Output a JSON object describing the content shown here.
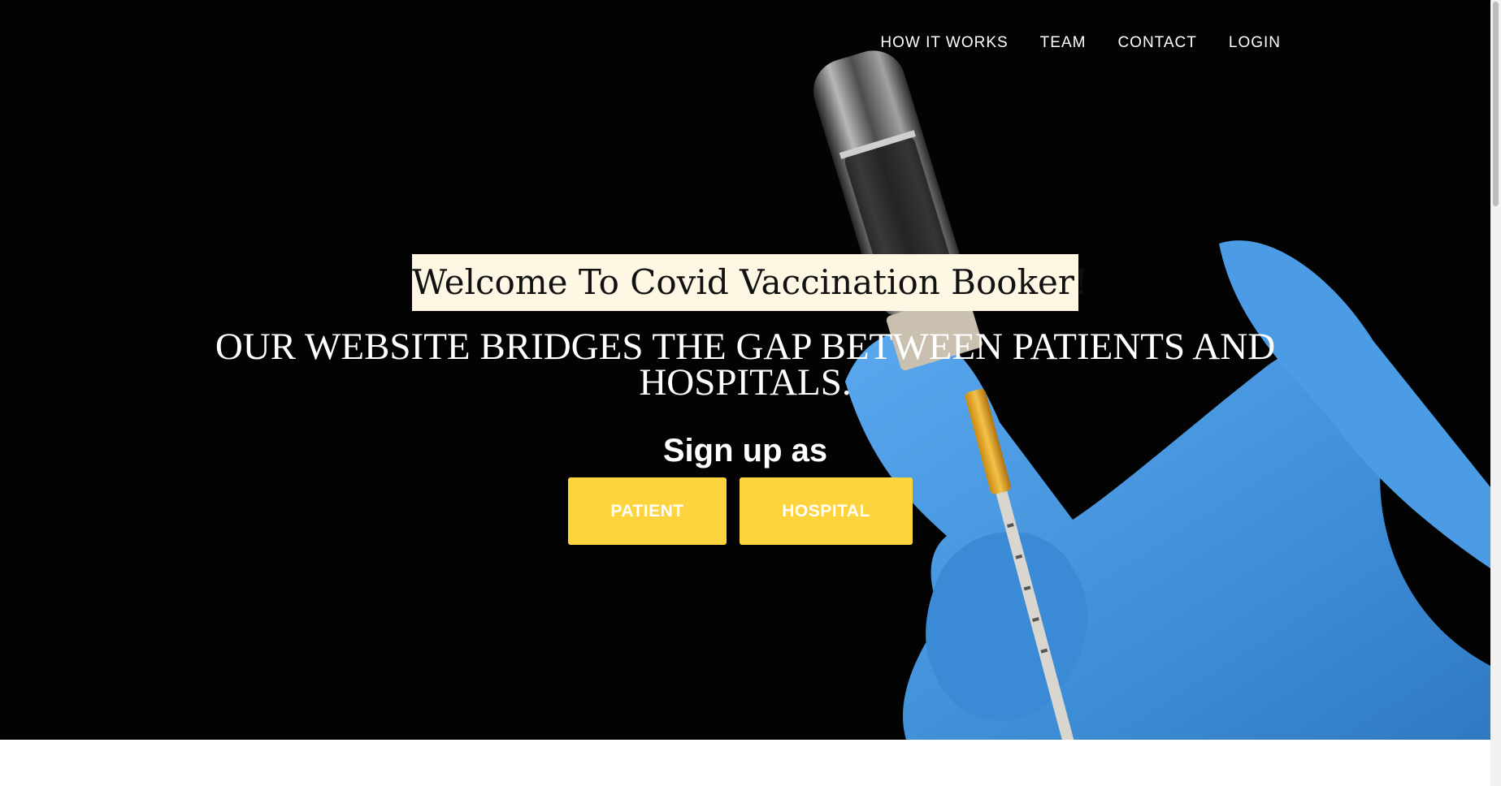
{
  "nav": {
    "items": [
      {
        "label": "HOW IT WORKS"
      },
      {
        "label": "TEAM"
      },
      {
        "label": "CONTACT"
      },
      {
        "label": "LOGIN"
      }
    ]
  },
  "hero": {
    "welcome": "Welcome To Covid Vaccination Booker!",
    "tagline": "OUR WEBSITE BRIDGES THE GAP BETWEEN PATIENTS AND HOSPITALS.",
    "signup_label": "Sign up as",
    "buttons": {
      "patient": "PATIENT",
      "hospital": "HOSPITAL"
    },
    "image_subject": "gloved hand holding vaccine vial and syringe"
  },
  "colors": {
    "hero_background": "#030303",
    "accent_button": "#fdd33e",
    "glove_blue": "#4a9be0",
    "welcome_background": "#fdf7e3"
  }
}
